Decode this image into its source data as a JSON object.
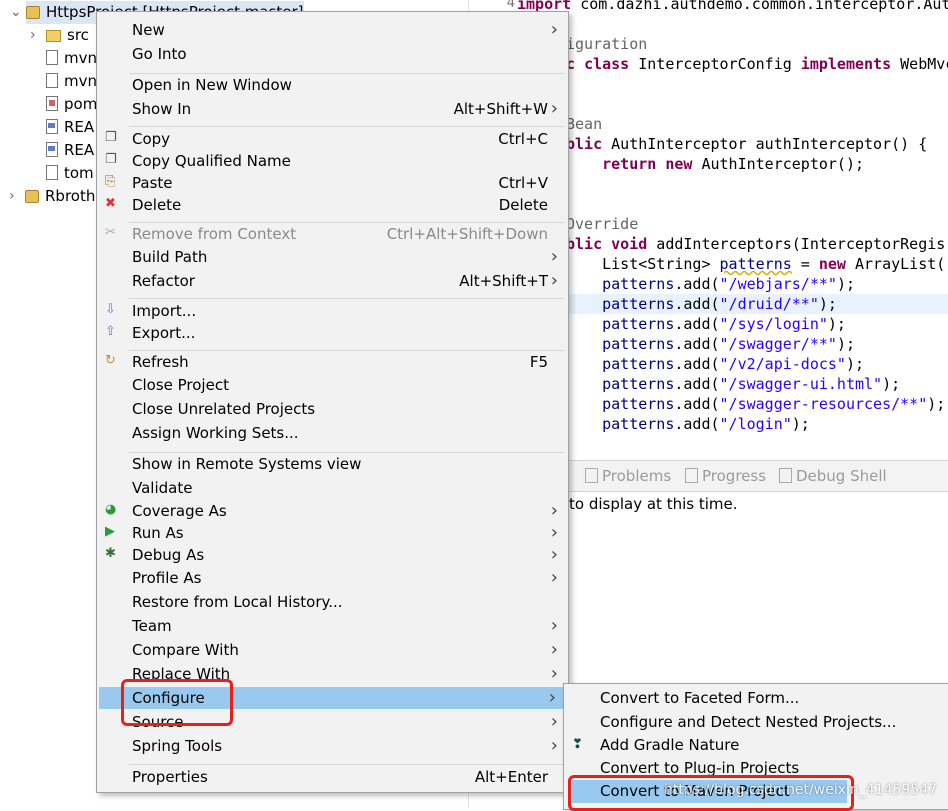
{
  "explorer": {
    "rows": [
      {
        "label": "HttpsProject [HttpsProject master]",
        "icon": "project-icon"
      },
      {
        "label": "src",
        "icon": "package-folder-icon"
      },
      {
        "label": "mvn",
        "icon": "file-icon"
      },
      {
        "label": "mvn",
        "icon": "file-icon"
      },
      {
        "label": "pom",
        "icon": "xml-file-icon"
      },
      {
        "label": "REA",
        "icon": "markdown-file-icon"
      },
      {
        "label": "REA",
        "icon": "markdown-file-icon"
      },
      {
        "label": "tom",
        "icon": "file-icon"
      },
      {
        "label": "Rbroth",
        "icon": "maven-project-icon"
      }
    ]
  },
  "editor": {
    "line_number": "4",
    "lines": [
      {
        "parts": [
          {
            "t": "import",
            "c": "kw"
          },
          {
            "t": " com.dazhi.authdemo.common.interceptor.Aut",
            "c": ""
          }
        ]
      },
      {
        "parts": []
      },
      {
        "parts": [
          {
            "t": "iguration",
            "c": "ann"
          }
        ]
      },
      {
        "parts": [
          {
            "t": "c ",
            "c": "kw"
          },
          {
            "t": "class",
            "c": "kw"
          },
          {
            "t": " InterceptorConfig ",
            "c": ""
          },
          {
            "t": "implements",
            "c": "kw"
          },
          {
            "t": " WebMvc",
            "c": ""
          }
        ]
      },
      {
        "parts": []
      },
      {
        "parts": []
      },
      {
        "parts": [
          {
            "t": "Bean",
            "c": "ann"
          }
        ]
      },
      {
        "parts": [
          {
            "t": "blic",
            "c": "kw"
          },
          {
            "t": " AuthInterceptor authInterceptor() {",
            "c": ""
          }
        ]
      },
      {
        "parts": [
          {
            "t": "    ",
            "c": ""
          },
          {
            "t": "return",
            "c": "kw"
          },
          {
            "t": " ",
            "c": ""
          },
          {
            "t": "new",
            "c": "kw"
          },
          {
            "t": " AuthInterceptor();",
            "c": ""
          }
        ]
      },
      {
        "parts": []
      },
      {
        "parts": []
      },
      {
        "parts": [
          {
            "t": "Override",
            "c": "ann"
          }
        ]
      },
      {
        "parts": [
          {
            "t": "blic",
            "c": "kw"
          },
          {
            "t": " ",
            "c": ""
          },
          {
            "t": "void",
            "c": "kw"
          },
          {
            "t": " addInterceptors(InterceptorRegis",
            "c": ""
          }
        ]
      },
      {
        "parts": [
          {
            "t": "    List<String> ",
            "c": ""
          },
          {
            "t": "patterns",
            "c": "var u-warn"
          },
          {
            "t": " = ",
            "c": ""
          },
          {
            "t": "new",
            "c": "kw"
          },
          {
            "t": " ArrayList();",
            "c": ""
          }
        ]
      },
      {
        "parts": [
          {
            "t": "    patterns",
            "c": "var"
          },
          {
            "t": ".add(",
            "c": ""
          },
          {
            "t": "\"/webjars/**\"",
            "c": "str"
          },
          {
            "t": ");",
            "c": ""
          }
        ]
      },
      {
        "parts": [
          {
            "t": "    patterns",
            "c": "var"
          },
          {
            "t": ".add(",
            "c": ""
          },
          {
            "t": "\"/druid/**\"",
            "c": "str"
          },
          {
            "t": ");",
            "c": ""
          }
        ],
        "highlight": true
      },
      {
        "parts": [
          {
            "t": "    patterns",
            "c": "var"
          },
          {
            "t": ".add(",
            "c": ""
          },
          {
            "t": "\"/sys/login\"",
            "c": "str"
          },
          {
            "t": ");",
            "c": ""
          }
        ]
      },
      {
        "parts": [
          {
            "t": "    patterns",
            "c": "var"
          },
          {
            "t": ".add(",
            "c": ""
          },
          {
            "t": "\"/swagger/**\"",
            "c": "str"
          },
          {
            "t": ");",
            "c": ""
          }
        ]
      },
      {
        "parts": [
          {
            "t": "    patterns",
            "c": "var"
          },
          {
            "t": ".add(",
            "c": ""
          },
          {
            "t": "\"/v2/api-docs\"",
            "c": "str"
          },
          {
            "t": ");",
            "c": ""
          }
        ]
      },
      {
        "parts": [
          {
            "t": "    patterns",
            "c": "var"
          },
          {
            "t": ".add(",
            "c": ""
          },
          {
            "t": "\"/swagger-ui.html\"",
            "c": "str"
          },
          {
            "t": ");",
            "c": ""
          }
        ]
      },
      {
        "parts": [
          {
            "t": "    patterns",
            "c": "var"
          },
          {
            "t": ".add(",
            "c": ""
          },
          {
            "t": "\"/swagger-resources/**\"",
            "c": "str"
          },
          {
            "t": ");",
            "c": ""
          }
        ]
      },
      {
        "parts": [
          {
            "t": "    patterns",
            "c": "var"
          },
          {
            "t": ".add(",
            "c": ""
          },
          {
            "t": "\"/login\"",
            "c": "str"
          },
          {
            "t": ");",
            "c": ""
          }
        ]
      }
    ]
  },
  "views": {
    "tabs": [
      {
        "label": "Problems",
        "icon": "problems-icon"
      },
      {
        "label": "Progress",
        "icon": "progress-icon"
      },
      {
        "label": "Debug Shell",
        "icon": "debug-shell-icon"
      }
    ],
    "message": "to display at this time."
  },
  "context_menu": {
    "items": [
      {
        "label": "New",
        "submenu": true
      },
      {
        "label": "Go Into"
      },
      {
        "sep": true
      },
      {
        "label": "Open in New Window"
      },
      {
        "label": "Show In",
        "accel": "Alt+Shift+W",
        "submenu": true
      },
      {
        "sep": true
      },
      {
        "label": "Copy",
        "accel": "Ctrl+C",
        "icon": "copy-icon"
      },
      {
        "label": "Copy Qualified Name",
        "icon": "copy-qualified-icon"
      },
      {
        "label": "Paste",
        "accel": "Ctrl+V",
        "icon": "paste-icon"
      },
      {
        "label": "Delete",
        "accel": "Delete",
        "icon": "delete-icon"
      },
      {
        "sep": true
      },
      {
        "label": "Remove from Context",
        "accel": "Ctrl+Alt+Shift+Down",
        "icon": "remove-context-icon",
        "disabled": true
      },
      {
        "label": "Build Path",
        "submenu": true
      },
      {
        "label": "Refactor",
        "accel": "Alt+Shift+T",
        "submenu": true
      },
      {
        "sep": true
      },
      {
        "label": "Import...",
        "icon": "import-icon"
      },
      {
        "label": "Export...",
        "icon": "export-icon"
      },
      {
        "sep": true
      },
      {
        "label": "Refresh",
        "accel": "F5",
        "icon": "refresh-icon"
      },
      {
        "label": "Close Project"
      },
      {
        "label": "Close Unrelated Projects"
      },
      {
        "label": "Assign Working Sets..."
      },
      {
        "sep": true
      },
      {
        "label": "Show in Remote Systems view"
      },
      {
        "label": "Validate"
      },
      {
        "label": "Coverage As",
        "submenu": true,
        "icon": "coverage-icon"
      },
      {
        "label": "Run As",
        "submenu": true,
        "icon": "run-icon"
      },
      {
        "label": "Debug As",
        "submenu": true,
        "icon": "debug-icon"
      },
      {
        "label": "Profile As",
        "submenu": true
      },
      {
        "label": "Restore from Local History..."
      },
      {
        "label": "Team",
        "submenu": true
      },
      {
        "label": "Compare With",
        "submenu": true
      },
      {
        "label": "Replace With",
        "submenu": true
      },
      {
        "label": "Configure",
        "submenu": true,
        "selected": true
      },
      {
        "label": "Source",
        "submenu": true
      },
      {
        "label": "Spring Tools",
        "submenu": true
      },
      {
        "sep": true
      },
      {
        "label": "Properties",
        "accel": "Alt+Enter"
      }
    ]
  },
  "submenu": {
    "items": [
      {
        "label": "Convert to Faceted Form..."
      },
      {
        "label": "Configure and Detect Nested Projects..."
      },
      {
        "label": "Add Gradle Nature",
        "icon": "gradle-icon"
      },
      {
        "label": "Convert to Plug-in Projects"
      },
      {
        "label": "Convert to Maven Project",
        "selected": true
      }
    ]
  },
  "watermark": "https://blog.csdn.net/weixin_41459547",
  "colors": {
    "highlight": "#99c9ef",
    "annotation_box": "#e8201a",
    "keyword": "#7f0055",
    "string": "#2a00ff"
  }
}
